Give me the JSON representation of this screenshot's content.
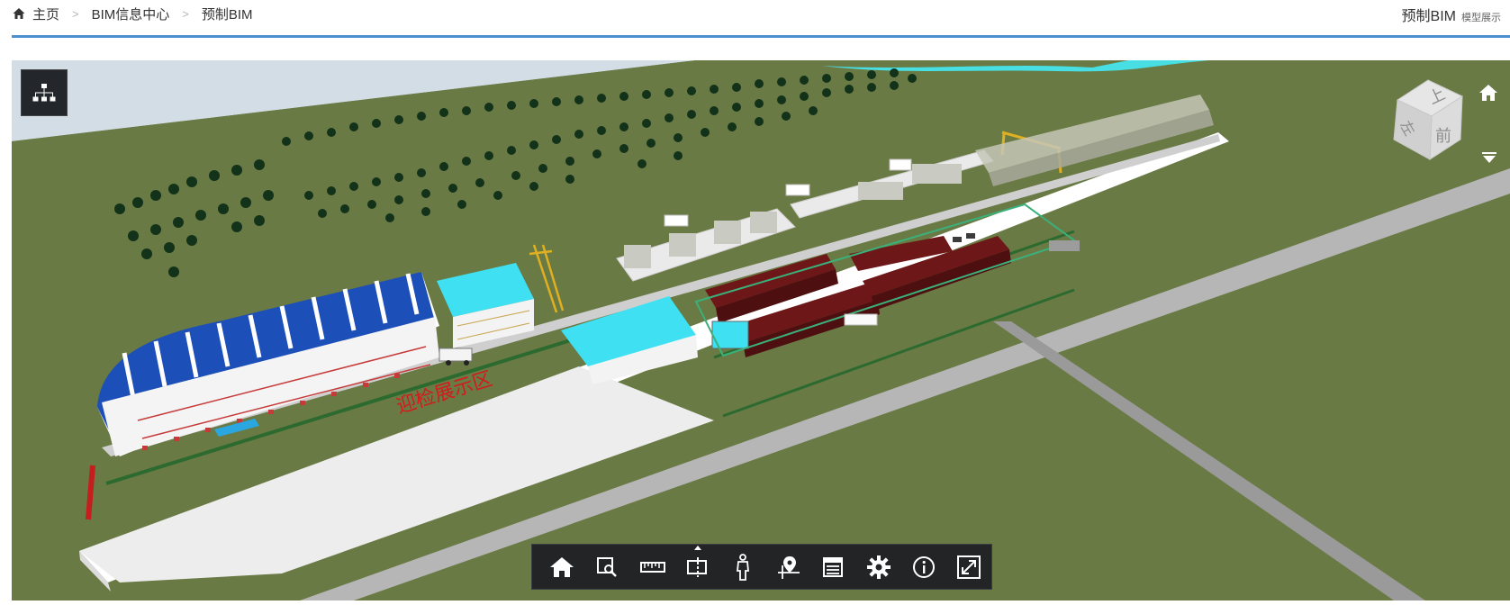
{
  "breadcrumb": {
    "home": "主页",
    "items": [
      "BIM信息中心",
      "预制BIM"
    ],
    "separator": ">"
  },
  "page_title": {
    "main": "预制BIM",
    "sub": "模型展示"
  },
  "scene": {
    "banner_text": "迎检展示区",
    "sky_color": "#d2dde6",
    "ground_color": "#6a7a45",
    "road_color": "#b6b6b6",
    "roof_blue": "#1d4fb8",
    "cyan": "#3fe0f2",
    "dark_red": "#6e1718"
  },
  "viewcube": {
    "faces": {
      "top": "上",
      "front": "前",
      "left": "左"
    }
  },
  "icons": {
    "tree": "model-tree-icon",
    "home_view": "home-icon",
    "cube_menu": "chevron-down-icon"
  },
  "toolbar": {
    "tools": [
      {
        "id": "home",
        "icon": "home-icon"
      },
      {
        "id": "zoom-window",
        "icon": "zoom-window-icon"
      },
      {
        "id": "measure",
        "icon": "ruler-icon"
      },
      {
        "id": "section",
        "icon": "section-box-icon"
      },
      {
        "id": "walk",
        "icon": "person-icon"
      },
      {
        "id": "location",
        "icon": "map-pin-icon"
      },
      {
        "id": "properties",
        "icon": "properties-list-icon"
      },
      {
        "id": "settings",
        "icon": "gear-icon"
      },
      {
        "id": "info",
        "icon": "info-icon"
      },
      {
        "id": "fullscreen",
        "icon": "fullscreen-icon"
      }
    ]
  }
}
